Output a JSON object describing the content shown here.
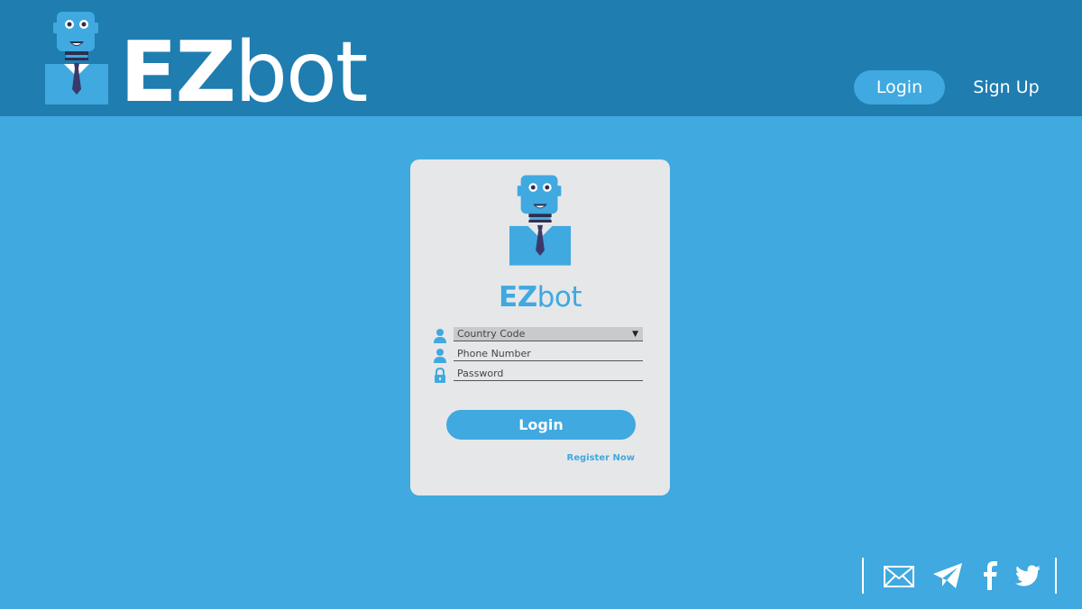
{
  "header": {
    "brand": {
      "bold": "EZ",
      "light": "bot"
    },
    "nav": {
      "login_label": "Login",
      "signup_label": "Sign Up"
    }
  },
  "login_card": {
    "brand": {
      "bold": "EZ",
      "light": "bot"
    },
    "fields": {
      "country_code": {
        "value": "Country Code",
        "icon": "user-icon"
      },
      "phone_number": {
        "placeholder": "Phone Number",
        "icon": "user-icon"
      },
      "password": {
        "placeholder": "Password",
        "icon": "lock-icon"
      }
    },
    "login_button_label": "Login",
    "register_link_label": "Register Now"
  },
  "footer": {
    "social_icons": [
      "mail-icon",
      "telegram-icon",
      "facebook-icon",
      "twitter-icon"
    ]
  },
  "colors": {
    "background": "#3fa9e0",
    "header": "#1f7db0",
    "card": "#e6e7e9",
    "accent": "#3fa9e0",
    "tie": "#3a3a6a"
  }
}
